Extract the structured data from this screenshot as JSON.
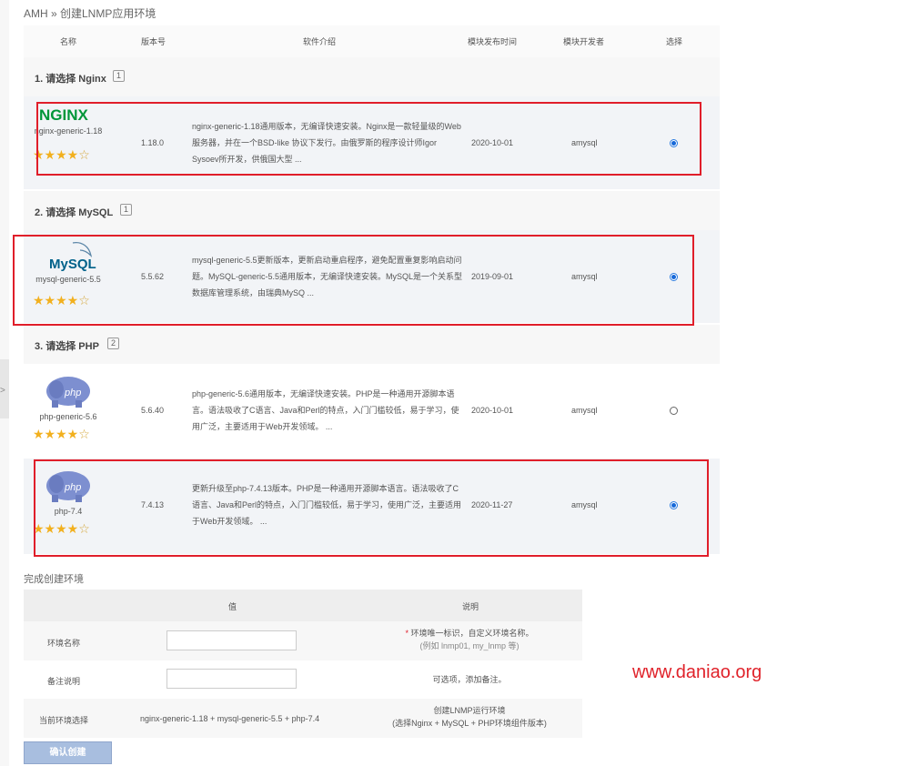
{
  "breadcrumb": "AMH » 创建LNMP应用环境",
  "table": {
    "headers": {
      "name": "名称",
      "version": "版本号",
      "intro": "软件介绍",
      "date": "模块发布时间",
      "dev": "模块开发者",
      "select": "选择"
    },
    "sections": [
      {
        "label": "1. 请选择 Nginx",
        "num": "1"
      },
      {
        "label": "2. 请选择 MySQL",
        "num": "1"
      },
      {
        "label": "3. 请选择 PHP",
        "num": "2"
      }
    ],
    "rows": [
      {
        "logo": "NGINX",
        "module": "nginx-generic-1.18",
        "version": "1.18.0",
        "desc": "nginx-generic-1.18通用版本，无编译快速安装。Nginx是一款轻量级的Web 服务器，并在一个BSD-like 协议下发行。由俄罗斯的程序设计师Igor Sysoev所开发，供俄国大型 ...",
        "date": "2020-10-01",
        "dev": "amysql",
        "selected": true,
        "stars": 4
      },
      {
        "logo": "MySQL",
        "module": "mysql-generic-5.5",
        "version": "5.5.62",
        "desc": "mysql-generic-5.5更新版本，更新启动重启程序，避免配置重复影响启动问题。MySQL-generic-5.5通用版本，无编译快速安装。MySQL是一个关系型数据库管理系统，由瑞典MySQ ...",
        "date": "2019-09-01",
        "dev": "amysql",
        "selected": true,
        "stars": 4
      },
      {
        "logo": "php",
        "module": "php-generic-5.6",
        "version": "5.6.40",
        "desc": "php-generic-5.6通用版本，无编译快速安装。PHP是一种通用开源脚本语言。语法吸收了C语言、Java和Perl的特点，入门门槛较低，易于学习，使用广泛，主要适用于Web开发领域。 ...",
        "date": "2020-10-01",
        "dev": "amysql",
        "selected": false,
        "stars": 4
      },
      {
        "logo": "php",
        "module": "php-7.4",
        "version": "7.4.13",
        "desc": "更新升级至php-7.4.13版本。PHP是一种通用开源脚本语言。语法吸收了C语言、Java和Perl的特点，入门门槛较低，易于学习，使用广泛，主要适用于Web开发领域。 ...",
        "date": "2020-11-27",
        "dev": "amysql",
        "selected": true,
        "stars": 4
      }
    ]
  },
  "form": {
    "title": "完成创建环境",
    "headers": {
      "value": "值",
      "explain": "说明"
    },
    "env_name": {
      "label": "环境名称",
      "value": "",
      "note_req": "*",
      "note_line1": "环境唯一标识，自定义环境名称。",
      "note_line2": "(例如 lnmp01, my_lnmp 等)"
    },
    "remark": {
      "label": "备注说明",
      "value": "",
      "note": "可选项，添加备注。"
    },
    "current": {
      "label": "当前环境选择",
      "value": "nginx-generic-1.18 + mysql-generic-5.5 + php-7.4",
      "note_line1": "创建LNMP运行环境",
      "note_line2": "(选择Nginx + MySQL + PHP环境组件版本)"
    },
    "submit": "确认创建"
  },
  "watermark": "www.daniao.org",
  "colors": {
    "highlight_box": "#e01e2a",
    "radio_selected": "#1668d8",
    "nginx_green": "#009639",
    "mysql_blue": "#00618a",
    "php_purple": "#5b6fb3",
    "star": "#f2b01e"
  }
}
